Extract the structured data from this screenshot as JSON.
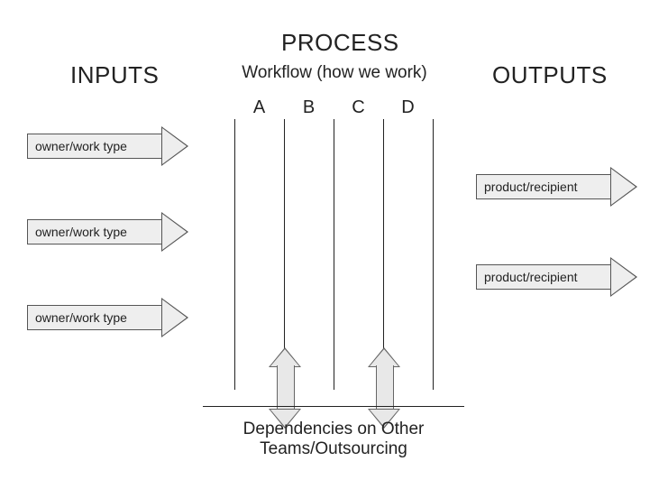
{
  "titles": {
    "process": "PROCESS",
    "inputs": "INPUTS",
    "outputs": "OUTPUTS",
    "workflow": "Workflow (how we work)",
    "dependencies_l1": "Dependencies on Other",
    "dependencies_l2": "Teams/Outsourcing"
  },
  "columns": [
    "A",
    "B",
    "C",
    "D"
  ],
  "inputs": [
    {
      "label": "owner/work type"
    },
    {
      "label": "owner/work type"
    },
    {
      "label": "owner/work type"
    }
  ],
  "outputs": [
    {
      "label": "product/recipient"
    },
    {
      "label": "product/recipient"
    }
  ]
}
